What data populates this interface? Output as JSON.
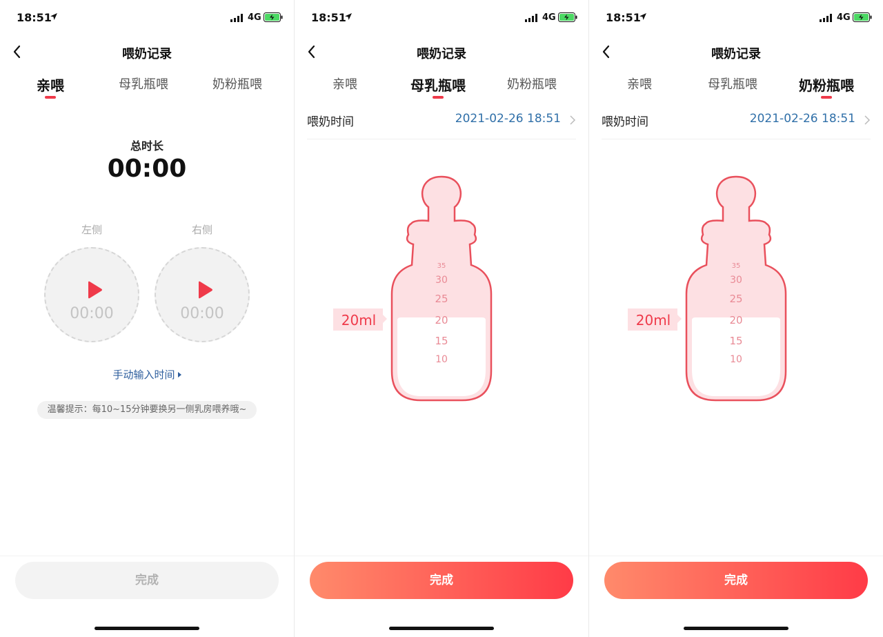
{
  "status": {
    "time": "18:51",
    "network": "4G"
  },
  "nav": {
    "title": "喂奶记录"
  },
  "tabs": [
    "亲喂",
    "母乳瓶喂",
    "奶粉瓶喂"
  ],
  "breast": {
    "total_label": "总时长",
    "total_value": "00:00",
    "left_label": "左侧",
    "right_label": "右侧",
    "left_time": "00:00",
    "right_time": "00:00",
    "manual_link": "手动输入时间",
    "tip": "温馨提示：每10~15分钟要换另一侧乳房喂养哦~"
  },
  "bottle": {
    "time_label": "喂奶时间",
    "time_value": "2021-02-26 18:51",
    "amount_label": "20ml",
    "scale": [
      "35",
      "30",
      "25",
      "20",
      "15",
      "10"
    ]
  },
  "done_label": "完成",
  "colors": {
    "accent": "#ef3a4a",
    "link": "#2f6fa8",
    "bottle_fill": "#fde0e3",
    "bottle_stroke": "#e9505c"
  }
}
